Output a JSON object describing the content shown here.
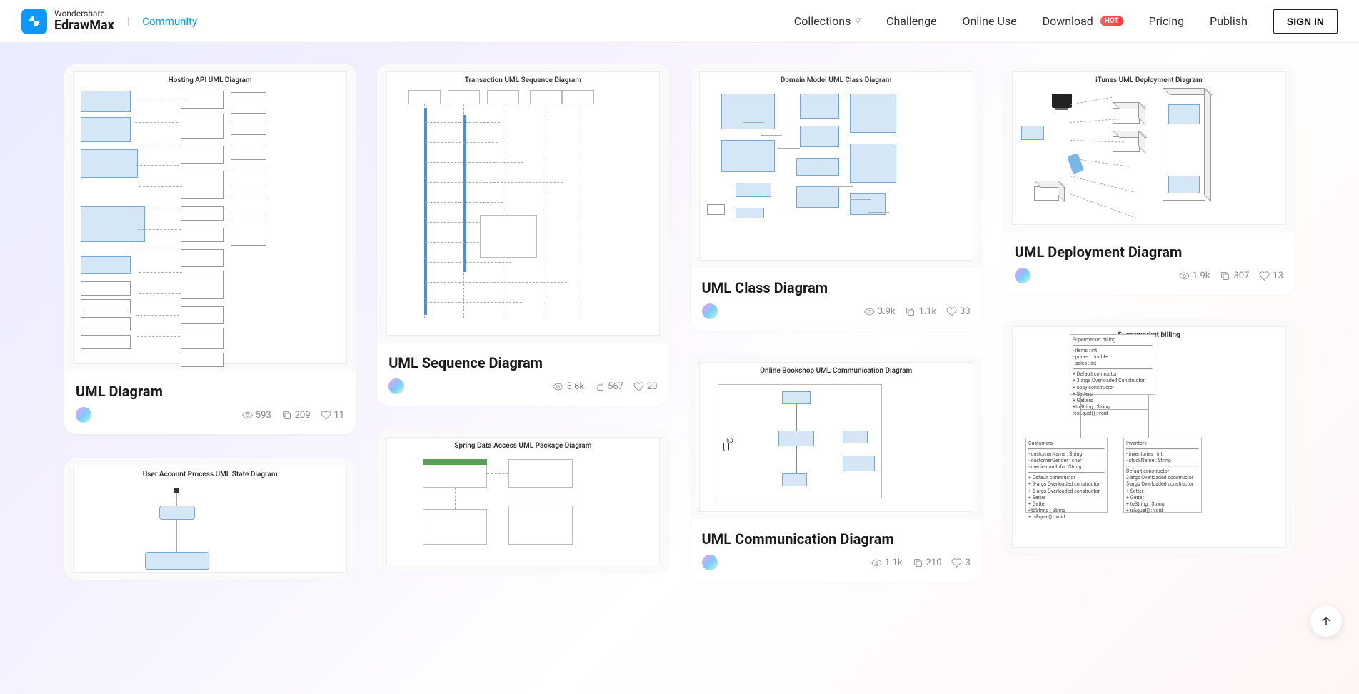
{
  "header": {
    "brand": "Wondershare",
    "product": "EdrawMax",
    "community": "Community",
    "nav": {
      "collections": "Collections",
      "challenge": "Challenge",
      "online_use": "Online Use",
      "download": "Download",
      "download_badge": "HOT",
      "pricing": "Pricing",
      "publish": "Publish"
    },
    "signin": "SIGN IN"
  },
  "cards": [
    {
      "thumb_title": "Hosting API UML Diagram",
      "title": "UML Diagram",
      "views": "593",
      "copies": "209",
      "likes": "11",
      "thumb_height": 430,
      "style": "hosting"
    },
    {
      "thumb_title": "User Account Process UML State Diagram",
      "title": "",
      "views": "",
      "copies": "",
      "likes": "",
      "thumb_height": 170,
      "style": "state",
      "partial": true
    },
    {
      "thumb_title": "Transaction UML Sequence Diagram",
      "title": "UML Sequence Diagram",
      "views": "5.6k",
      "copies": "567",
      "likes": "20",
      "thumb_height": 390,
      "style": "sequence"
    },
    {
      "thumb_title": "Spring Data Access UML Package Diagram",
      "title": "",
      "views": "",
      "copies": "",
      "likes": "",
      "thumb_height": 200,
      "style": "package",
      "partial": true
    },
    {
      "thumb_title": "Domain Model UML Class Diagram",
      "title": "UML Class Diagram",
      "views": "3.9k",
      "copies": "1.1k",
      "likes": "33",
      "thumb_height": 285,
      "style": "class"
    },
    {
      "thumb_title": "Online Bookshop UML Communication Diagram",
      "title": "UML Communication Diagram",
      "views": "1.1k",
      "copies": "210",
      "likes": "3",
      "thumb_height": 230,
      "style": "comm"
    },
    {
      "thumb_title": "iTunes UML Deployment Diagram",
      "title": "UML Deployment Diagram",
      "views": "1.9k",
      "copies": "307",
      "likes": "13",
      "thumb_height": 235,
      "style": "deploy"
    },
    {
      "thumb_title": "Supermarket billing",
      "title": "",
      "views": "",
      "copies": "",
      "likes": "",
      "thumb_height": 330,
      "style": "supermarket",
      "partial": true
    }
  ]
}
